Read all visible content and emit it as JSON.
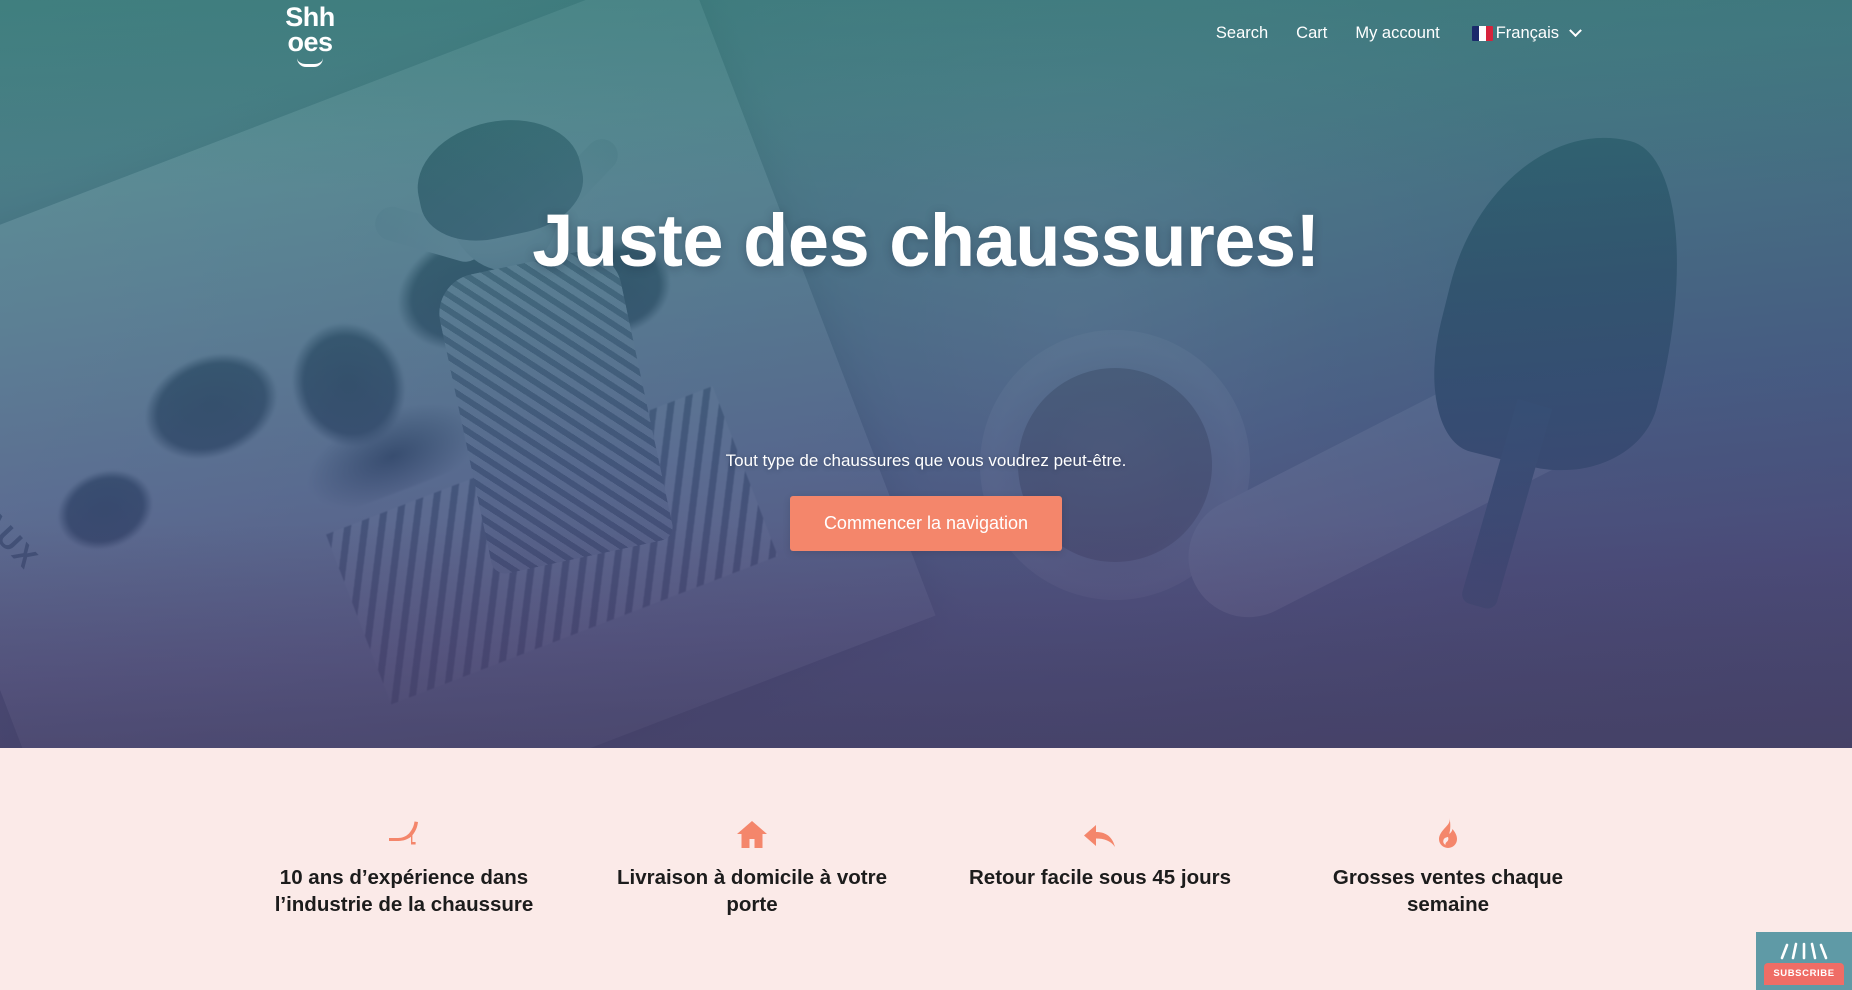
{
  "brand": {
    "logo_top": "Shh",
    "logo_bottom": "oes",
    "accent_color": "#f4866b",
    "hero_gradient_start": "#347d7a",
    "hero_gradient_end": "#474268",
    "features_bg": "#fbeae8"
  },
  "nav": {
    "items": [
      {
        "label": "Search",
        "name": "search"
      },
      {
        "label": "Cart",
        "name": "cart"
      },
      {
        "label": "My account",
        "name": "my-account"
      }
    ],
    "language": {
      "label": "Français",
      "flag": "france-flag-icon",
      "chevron": "chevron-down-icon"
    }
  },
  "hero": {
    "title": "Juste des chaussures!",
    "subtitle": "Tout type de chaussures que vous voudrez peut-être.",
    "cta_label": "Commencer la navigation",
    "magazine_edge_text": "AUX"
  },
  "features": [
    {
      "icon": "high-heel-shoe-icon",
      "text": "10 ans d’expérience dans l’industrie de la chaussure"
    },
    {
      "icon": "house-icon",
      "text": "Livraison à domicile à votre porte"
    },
    {
      "icon": "reply-arrow-icon",
      "text": "Retour facile sous 45 jours"
    },
    {
      "icon": "flame-icon",
      "text": "Grosses ventes chaque semaine"
    }
  ],
  "subscribe_widget": {
    "label": "SUBSCRIBE",
    "background_color": "#5f9aa6",
    "button_color": "#ef6d66"
  }
}
